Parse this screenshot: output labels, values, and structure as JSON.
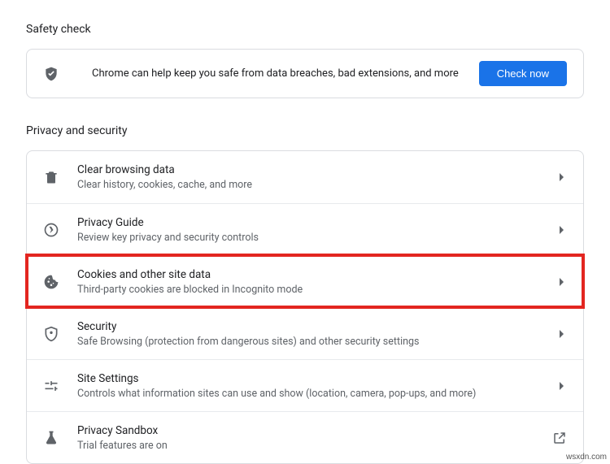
{
  "safety_check": {
    "heading": "Safety check",
    "text": "Chrome can help keep you safe from data breaches, bad extensions, and more",
    "button": "Check now"
  },
  "privacy": {
    "heading": "Privacy and security",
    "items": [
      {
        "title": "Clear browsing data",
        "sub": "Clear history, cookies, cache, and more",
        "icon": "trash-icon",
        "action": "arrow"
      },
      {
        "title": "Privacy Guide",
        "sub": "Review key privacy and security controls",
        "icon": "compass-icon",
        "action": "arrow"
      },
      {
        "title": "Cookies and other site data",
        "sub": "Third-party cookies are blocked in Incognito mode",
        "icon": "cookie-icon",
        "action": "arrow",
        "highlight": true
      },
      {
        "title": "Security",
        "sub": "Safe Browsing (protection from dangerous sites) and other security settings",
        "icon": "shield-icon",
        "action": "arrow"
      },
      {
        "title": "Site Settings",
        "sub": "Controls what information sites can use and show (location, camera, pop-ups, and more)",
        "icon": "sliders-icon",
        "action": "arrow"
      },
      {
        "title": "Privacy Sandbox",
        "sub": "Trial features are on",
        "icon": "flask-icon",
        "action": "external"
      }
    ]
  },
  "watermark": "wsxdn.com"
}
